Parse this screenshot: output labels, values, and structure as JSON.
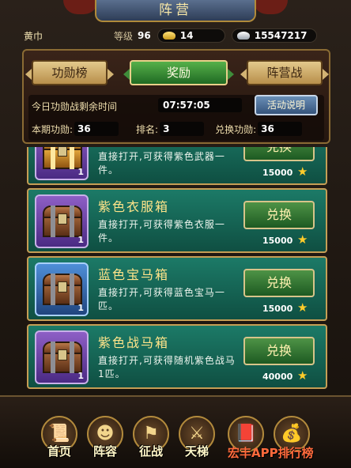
{
  "title": "阵营",
  "status": {
    "player_name": "黄巾",
    "level_label": "等级",
    "level": "96",
    "gold": "14",
    "silver": "15547217"
  },
  "tabs": [
    {
      "label": "功勋榜"
    },
    {
      "label": "奖励"
    },
    {
      "label": "阵营战"
    }
  ],
  "info": {
    "remaining_label": "今日功勋战剩余时间",
    "timer": "07:57:05",
    "explain_button": "活动说明",
    "merit_label": "本期功勋:",
    "merit": "36",
    "rank_label": "排名:",
    "rank": "3",
    "exchange_merit_label": "兑换功勋:",
    "exchange_merit": "36"
  },
  "items": [
    {
      "title": "",
      "desc": "直接打开,可获得紫色武器一件。",
      "qty": "1",
      "button": "兑换",
      "cost": "15000"
    },
    {
      "title": "紫色衣服箱",
      "desc": "直接打开,可获得紫色衣服一件。",
      "qty": "1",
      "button": "兑换",
      "cost": "15000"
    },
    {
      "title": "蓝色宝马箱",
      "desc": "直接打开,可获得蓝色宝马一匹。",
      "qty": "1",
      "button": "兑换",
      "cost": "15000"
    },
    {
      "title": "紫色战马箱",
      "desc": "直接打开,可获得随机紫色战马1匹。",
      "qty": "1",
      "button": "兑换",
      "cost": "40000"
    }
  ],
  "nav": [
    {
      "label": "首页"
    },
    {
      "label": "阵容"
    },
    {
      "label": "征战"
    },
    {
      "label": "天梯"
    },
    {
      "label": ""
    },
    {
      "label": ""
    }
  ],
  "watermark": "宏丰APP排行榜"
}
